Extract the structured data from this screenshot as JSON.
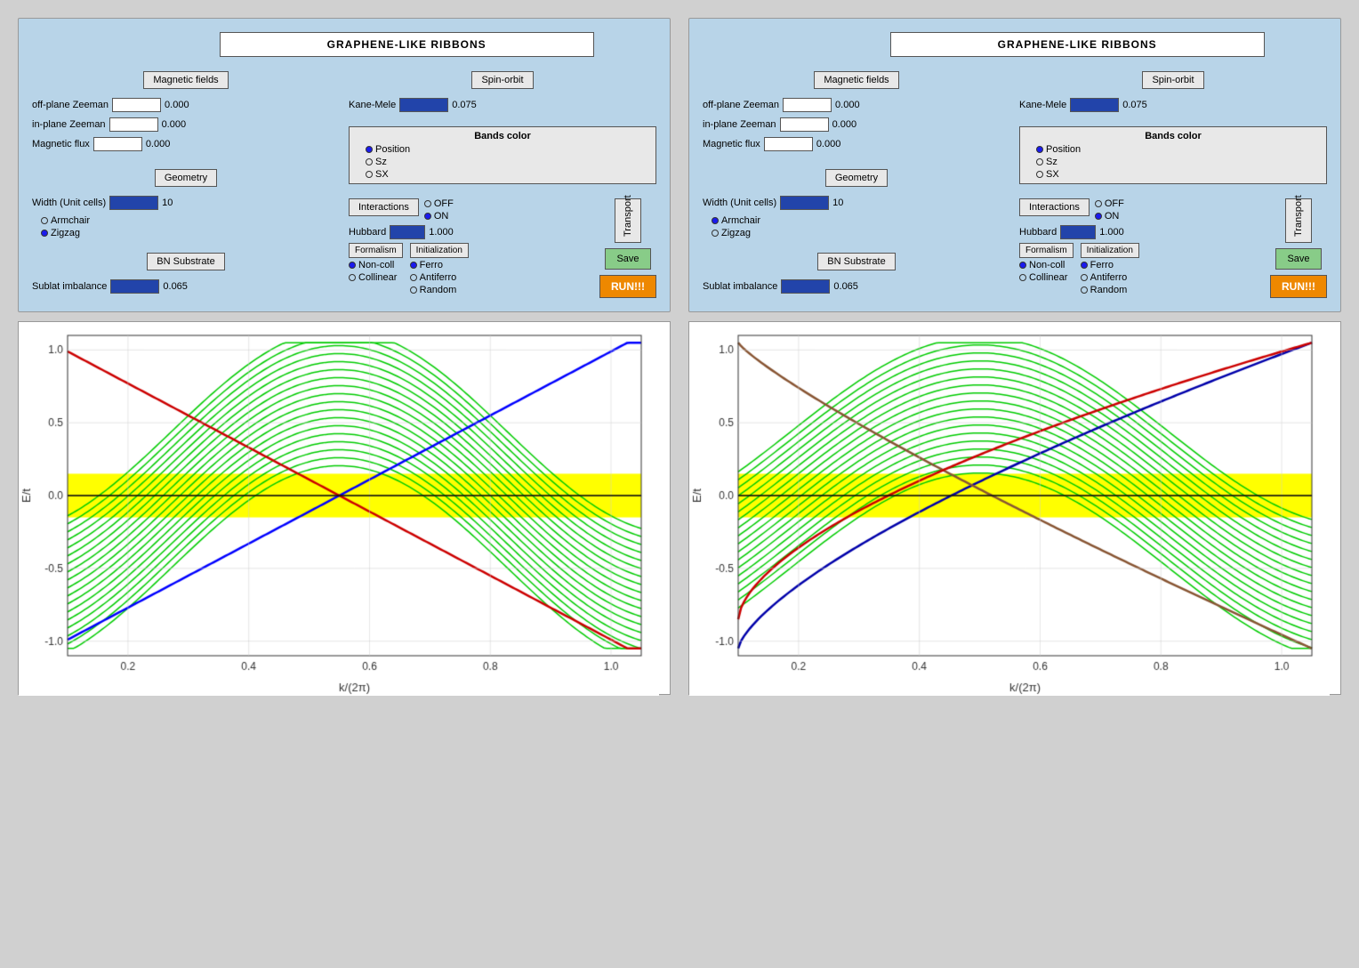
{
  "panel1": {
    "title": "GRAPHENE-LIKE RIBBONS",
    "magnetic_fields_label": "Magnetic fields",
    "spin_orbit_label": "Spin-orbit",
    "off_plane_zeeman_label": "off-plane Zeeman",
    "off_plane_zeeman_value": "0.000",
    "in_plane_zeeman_label": "in-plane Zeeman",
    "in_plane_zeeman_value": "0.000",
    "magnetic_flux_label": "Magnetic flux",
    "magnetic_flux_value": "0.000",
    "kane_mele_label": "Kane-Mele",
    "kane_mele_value": "0.075",
    "bands_color_label": "Bands color",
    "bands_color_options": [
      "Position",
      "Sz",
      "SX"
    ],
    "bands_color_selected": 0,
    "geometry_label": "Geometry",
    "width_label": "Width (Unit cells)",
    "width_value": "10",
    "armchair_label": "Armchair",
    "zigzag_label": "Zigzag",
    "zigzag_selected": true,
    "bn_substrate_label": "BN Substrate",
    "sublat_label": "Sublat imbalance",
    "sublat_value": "0.065",
    "interactions_label": "Interactions",
    "off_label": "OFF",
    "on_label": "ON",
    "off_selected": false,
    "on_selected": true,
    "hubbard_label": "Hubbard",
    "hubbard_value": "1.000",
    "formalism_label": "Formalism",
    "initialization_label": "Initialization",
    "non_coll_label": "Non-coll",
    "collinear_label": "Collinear",
    "non_coll_selected": true,
    "ferro_label": "Ferro",
    "antiferro_label": "Antiferro",
    "random_label": "Random",
    "ferro_selected": true,
    "transport_label": "Transport",
    "save_label": "Save",
    "run_label": "RUN!!!"
  },
  "panel2": {
    "title": "GRAPHENE-LIKE RIBBONS",
    "magnetic_fields_label": "Magnetic fields",
    "spin_orbit_label": "Spin-orbit",
    "off_plane_zeeman_label": "off-plane Zeeman",
    "off_plane_zeeman_value": "0.000",
    "in_plane_zeeman_label": "in-plane Zeeman",
    "in_plane_zeeman_value": "0.000",
    "magnetic_flux_label": "Magnetic flux",
    "magnetic_flux_value": "0.000",
    "kane_mele_label": "Kane-Mele",
    "kane_mele_value": "0.075",
    "bands_color_label": "Bands color",
    "bands_color_options": [
      "Position",
      "Sz",
      "SX"
    ],
    "bands_color_selected": 0,
    "geometry_label": "Geometry",
    "width_label": "Width (Unit cells)",
    "width_value": "10",
    "armchair_label": "Armchair",
    "zigzag_label": "Zigzag",
    "armchair_selected": true,
    "zigzag_selected": false,
    "bn_substrate_label": "BN Substrate",
    "sublat_label": "Sublat imbalance",
    "sublat_value": "0.065",
    "interactions_label": "Interactions",
    "off_label": "OFF",
    "on_label": "ON",
    "off_selected": false,
    "on_selected": true,
    "hubbard_label": "Hubbard",
    "hubbard_value": "1.000",
    "formalism_label": "Formalism",
    "initialization_label": "Initialization",
    "non_coll_label": "Non-coll",
    "collinear_label": "Collinear",
    "non_coll_selected": true,
    "ferro_label": "Ferro",
    "antiferro_label": "Antiferro",
    "random_label": "Random",
    "ferro_selected": true,
    "transport_label": "Transport",
    "save_label": "Save",
    "run_label": "RUN!!!"
  },
  "chart1": {
    "x_label": "k/(2π)",
    "y_label": "E/t",
    "x_min": 0.1,
    "x_max": 1.0,
    "y_min": -1.0,
    "y_max": 1.0,
    "x_ticks": [
      0.2,
      0.4,
      0.6,
      0.8,
      1.0
    ],
    "y_ticks": [
      -1.0,
      -0.5,
      0.0,
      0.5,
      1.0
    ]
  },
  "chart2": {
    "x_label": "k/(2π)",
    "y_label": "E/t",
    "x_min": 0.1,
    "x_max": 1.0,
    "y_min": -1.0,
    "y_max": 1.0,
    "x_ticks": [
      0.2,
      0.4,
      0.6,
      0.8,
      1.0
    ],
    "y_ticks": [
      -1.0,
      -0.5,
      0.0,
      0.5,
      1.0
    ]
  }
}
